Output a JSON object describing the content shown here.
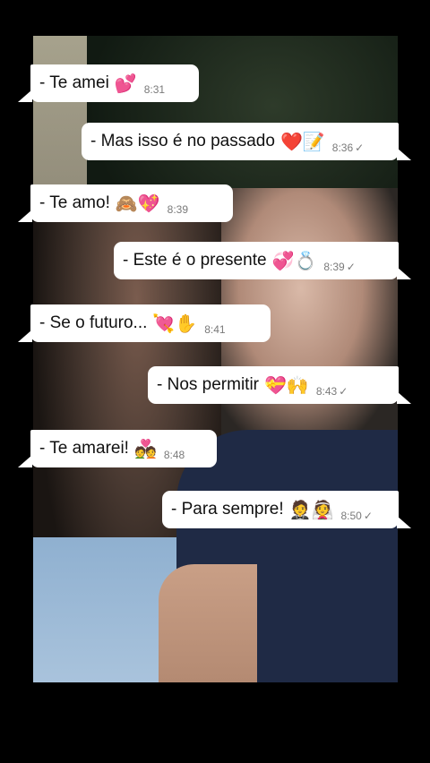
{
  "messages": [
    {
      "direction": "in",
      "text": "- Te amei",
      "emoji": "💕",
      "time": "8:31",
      "tick": ""
    },
    {
      "direction": "out",
      "text": "- Mas isso é no passado",
      "emoji": "❤️📝",
      "time": "8:36",
      "tick": "✓"
    },
    {
      "direction": "in",
      "text": "-  Te amo!",
      "emoji": "🙈💖",
      "time": "8:39",
      "tick": ""
    },
    {
      "direction": "out",
      "text": "- Este é o presente",
      "emoji": "💞💍",
      "time": "8:39",
      "tick": "✓"
    },
    {
      "direction": "in",
      "text": "-  Se o futuro...",
      "emoji": "💘✋",
      "time": "8:41",
      "tick": ""
    },
    {
      "direction": "out",
      "text": "-  Nos permitir",
      "emoji": "💝🙌",
      "time": "8:43",
      "tick": "✓"
    },
    {
      "direction": "in",
      "text": "- Te amarei!",
      "emoji": "💑",
      "time": "8:48",
      "tick": ""
    },
    {
      "direction": "out",
      "text": "- Para sempre!",
      "emoji": "🤵👰",
      "time": "8:50",
      "tick": "✓"
    }
  ],
  "colors": {
    "bubble": "#ffffff",
    "background": "#000000",
    "time": "#7a7a7a"
  }
}
